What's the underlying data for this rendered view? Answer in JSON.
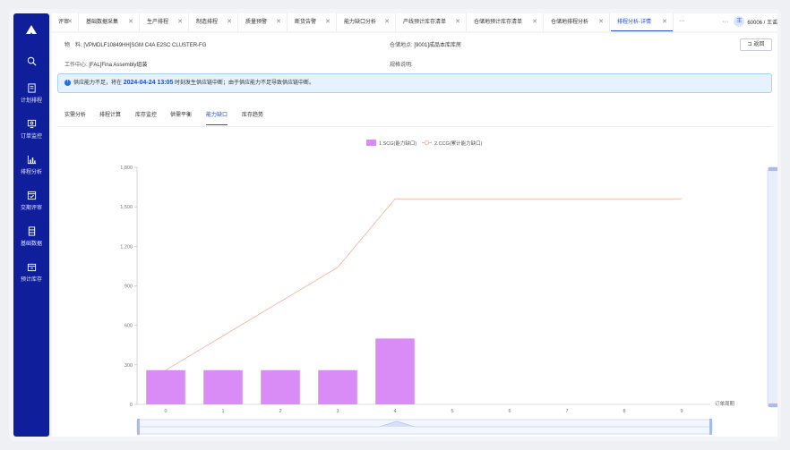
{
  "sidebar": {
    "items": [
      {
        "label": "",
        "icon": "search-icon"
      },
      {
        "label": "计划排程",
        "icon": "document-icon"
      },
      {
        "label": "订单监控",
        "icon": "monitor-icon"
      },
      {
        "label": "排程分析",
        "icon": "bar-chart-icon"
      },
      {
        "label": "交期评审",
        "icon": "checklist-icon"
      },
      {
        "label": "基础数据",
        "icon": "database-icon"
      },
      {
        "label": "预计库存",
        "icon": "inventory-icon"
      }
    ]
  },
  "tabs": [
    {
      "label": "评审"
    },
    {
      "label": "基础数据采集"
    },
    {
      "label": "生产排程"
    },
    {
      "label": "制造排程"
    },
    {
      "label": "质量预警"
    },
    {
      "label": "断货告警"
    },
    {
      "label": "能力缺口分析"
    },
    {
      "label": "产线预计库存清单"
    },
    {
      "label": "仓储地预计库存清单"
    },
    {
      "label": "仓储地排程分析"
    },
    {
      "label": "排程分析-详情"
    }
  ],
  "tab_more": "···",
  "user": {
    "more": "···",
    "avatar": "王",
    "name": "60006 / 王谣"
  },
  "detail": {
    "material_label": "物　料:",
    "material_value": "[VPMDLF10849HH]SGM C4A E2SC CLUSTER-FG",
    "work_center_label": "工作中心:",
    "work_center_value": "[FAL]Fina Assembly组装",
    "warehouse_label": "仓储地点:",
    "warehouse_value": "[9001]成品本库库房",
    "spec_label": "规格说明:",
    "spec_value": "",
    "back_label": "返回"
  },
  "alert": {
    "prefix": "供应能力不足，将在",
    "highlight": "2024-04-24 13:05",
    "suffix": "时刻发生供应链中断；由于供应能力不足导致供应链中断。"
  },
  "subtabs": [
    {
      "label": "实需分析"
    },
    {
      "label": "排程计算"
    },
    {
      "label": "库存监控"
    },
    {
      "label": "供需平衡"
    },
    {
      "label": "能力缺口"
    },
    {
      "label": "库存趋势"
    }
  ],
  "colors": {
    "sidebar": "#0f1f9b",
    "accent": "#1f4ee0",
    "bar": "#d98cf5",
    "line": "#f6b8a2"
  },
  "chart_data": {
    "type": "bar",
    "categories": [
      "0",
      "1",
      "2",
      "3",
      "4",
      "5",
      "6",
      "7",
      "8",
      "9"
    ],
    "series": [
      {
        "name": "1.SCG(能力缺口)",
        "type": "bar",
        "values": [
          260,
          260,
          260,
          260,
          500,
          0,
          0,
          0,
          0,
          0
        ]
      },
      {
        "name": "2.CCG(累计能力缺口)",
        "type": "line",
        "values": [
          260,
          520,
          780,
          1040,
          1560,
          1560,
          1560,
          1560,
          1560,
          1560
        ]
      }
    ],
    "xlabel": "订单周期",
    "ylim": [
      0,
      1800
    ],
    "yticks": [
      "0",
      "300",
      "600",
      "900",
      "1,200",
      "1,500",
      "1,800"
    ],
    "legend": "top-center",
    "grid": false
  }
}
